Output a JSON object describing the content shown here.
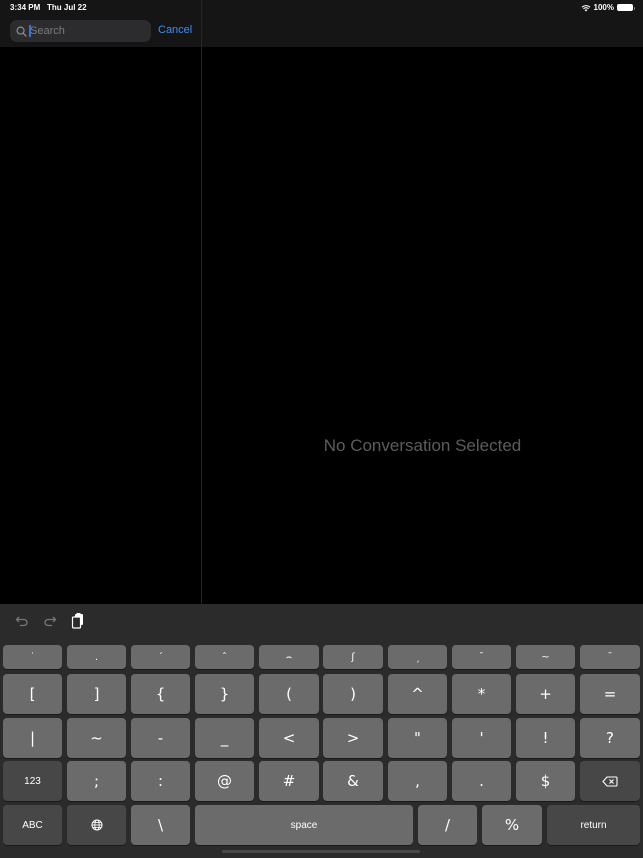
{
  "status_bar": {
    "time": "3:34 PM",
    "date": "Thu Jul 22",
    "battery": "100%",
    "icons": [
      "wifi-icon",
      "battery-icon"
    ]
  },
  "search": {
    "placeholder": "Search",
    "value": "",
    "cancel_label": "Cancel"
  },
  "detail": {
    "empty_message": "No Conversation Selected"
  },
  "colors": {
    "accent": "#3a8ef6",
    "key_bg": "#6b6b6b",
    "key_dark_bg": "#474747",
    "keyboard_bg": "#2b2b2b"
  },
  "keyboard": {
    "shortcuts": [
      {
        "name": "undo-icon"
      },
      {
        "name": "redo-icon"
      },
      {
        "name": "paste-icon"
      }
    ],
    "row0": [
      "˙",
      ".",
      "´",
      "ˆ",
      "⌢",
      "ʃ",
      "ˏ",
      "ˉ",
      "~",
      "ˉ"
    ],
    "row1": [
      "[",
      "]",
      "{",
      "}",
      "(",
      ")",
      "^",
      "*",
      "+",
      "="
    ],
    "row2": [
      "|",
      "~",
      "-",
      "_",
      "<",
      ">",
      "\"",
      "'",
      "!",
      "?"
    ],
    "row3": [
      "123",
      ";",
      ":",
      "@",
      "#",
      "&",
      ",",
      ".",
      "$",
      "delete"
    ],
    "row4": [
      "ABC",
      "globe",
      "\\",
      "space",
      "/",
      "%",
      "return"
    ]
  }
}
